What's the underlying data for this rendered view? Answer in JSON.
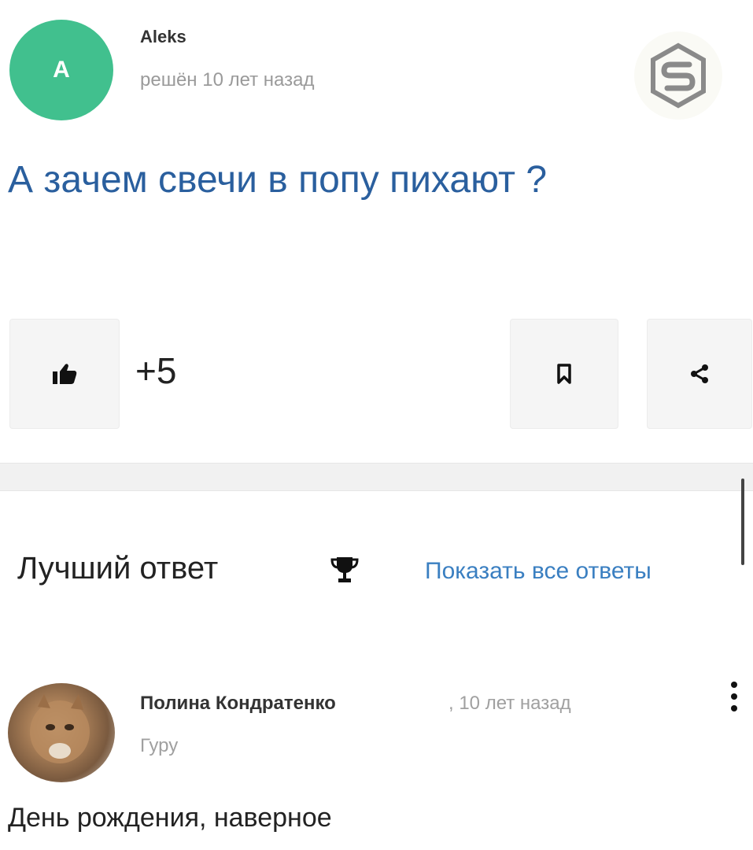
{
  "question": {
    "author": {
      "avatar_letter": "A",
      "avatar_color": "#41c08e",
      "name": "Aleks",
      "meta": "решён 10 лет назад"
    },
    "title": "А зачем свечи в попу пихают ?",
    "score": "+5",
    "actions": {
      "like_icon": "thumbs-up-icon",
      "bookmark_icon": "bookmark-icon",
      "share_icon": "share-icon"
    }
  },
  "answers_header": {
    "best_answer_label": "Лучший ответ",
    "best_answer_icon": "trophy-icon",
    "show_all_label": "Показать все ответы"
  },
  "best_answer": {
    "author": {
      "name": "Полина Кондратенко",
      "time": ", 10 лет назад",
      "rank": "Гуру"
    },
    "text": "День рождения, наверное",
    "menu_icon": "more-vertical-icon"
  },
  "colors": {
    "accent_blue": "#2a5f9e",
    "link_blue": "#3a7fc1",
    "avatar_green": "#41c08e"
  }
}
